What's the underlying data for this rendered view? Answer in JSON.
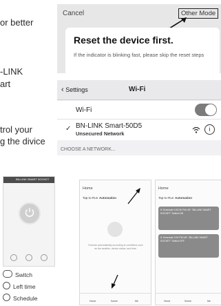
{
  "left_fragments": [
    "or better",
    "-LINK",
    "art",
    "trol your",
    "g the divice"
  ],
  "reset_dialog": {
    "cancel": "Cancel",
    "other_mode": "Other Mode",
    "title": "Reset the device first.",
    "description": "If the indicator is blinking fast, please skip the reset steps"
  },
  "wifi_settings": {
    "back": "Settings",
    "title": "Wi-Fi",
    "wifi_label": "Wi-Fi",
    "network_name": "BN-LINK Smart-50D5",
    "network_sub": "Unsecured Network",
    "choose": "CHOOSE A NETWORK..."
  },
  "thumb1": {
    "title": "BN-LINK SMART SOCKET"
  },
  "thumb2": {
    "header": "Home",
    "tab1": "Tap-to-Run",
    "tab2": "Automation",
    "empty_text": "Execute automatically according to conditions such as the weather, device status, and time.",
    "nav": [
      "Home",
      "Scene",
      "Me"
    ]
  },
  "thumb3": {
    "header": "Home",
    "tab1": "Tap-to-Run",
    "tab2": "Automation",
    "card1_text": "If: Schedule 0:30:30 PM UR: \"BN-LINK SMART SOCKET\" Switch:ON",
    "card2_text": "If: Schedule 2:00 PM UR: \"BN-LINK SMART SOCKET\" Switch:OFF",
    "nav": [
      "Home",
      "Scene",
      "Me"
    ]
  },
  "legend": [
    "Switch",
    "Left time",
    "Schedule"
  ],
  "colors": {
    "toggle": "#7b7b7b",
    "panel_gray": "#e7e7e7"
  }
}
